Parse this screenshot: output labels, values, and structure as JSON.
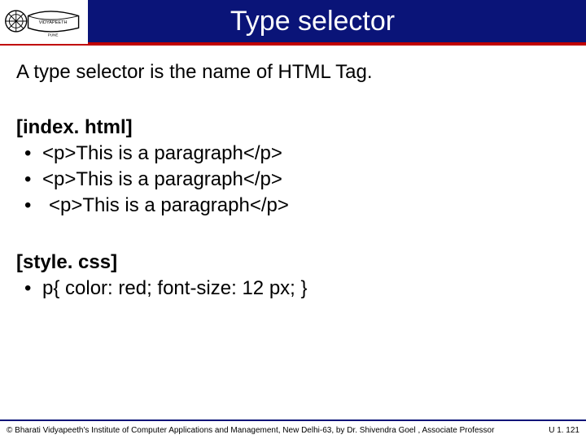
{
  "header": {
    "title": "Type selector"
  },
  "body": {
    "intro": "A type selector is the name of HTML Tag.",
    "section1_label": "[index. html]",
    "section1_items": [
      "<p>This is a paragraph</p>",
      "<p>This is a paragraph</p>",
      " <p>This is a paragraph</p>"
    ],
    "section2_label": "[style. css]",
    "section2_items": [
      "p{ color: red; font-size: 12 px; }"
    ]
  },
  "footer": {
    "copyright": "© Bharati Vidyapeeth's Institute of Computer Applications and Management, New Delhi-63, by Dr. Shivendra Goel , Associate Professor",
    "pageref": "U 1.  121"
  }
}
